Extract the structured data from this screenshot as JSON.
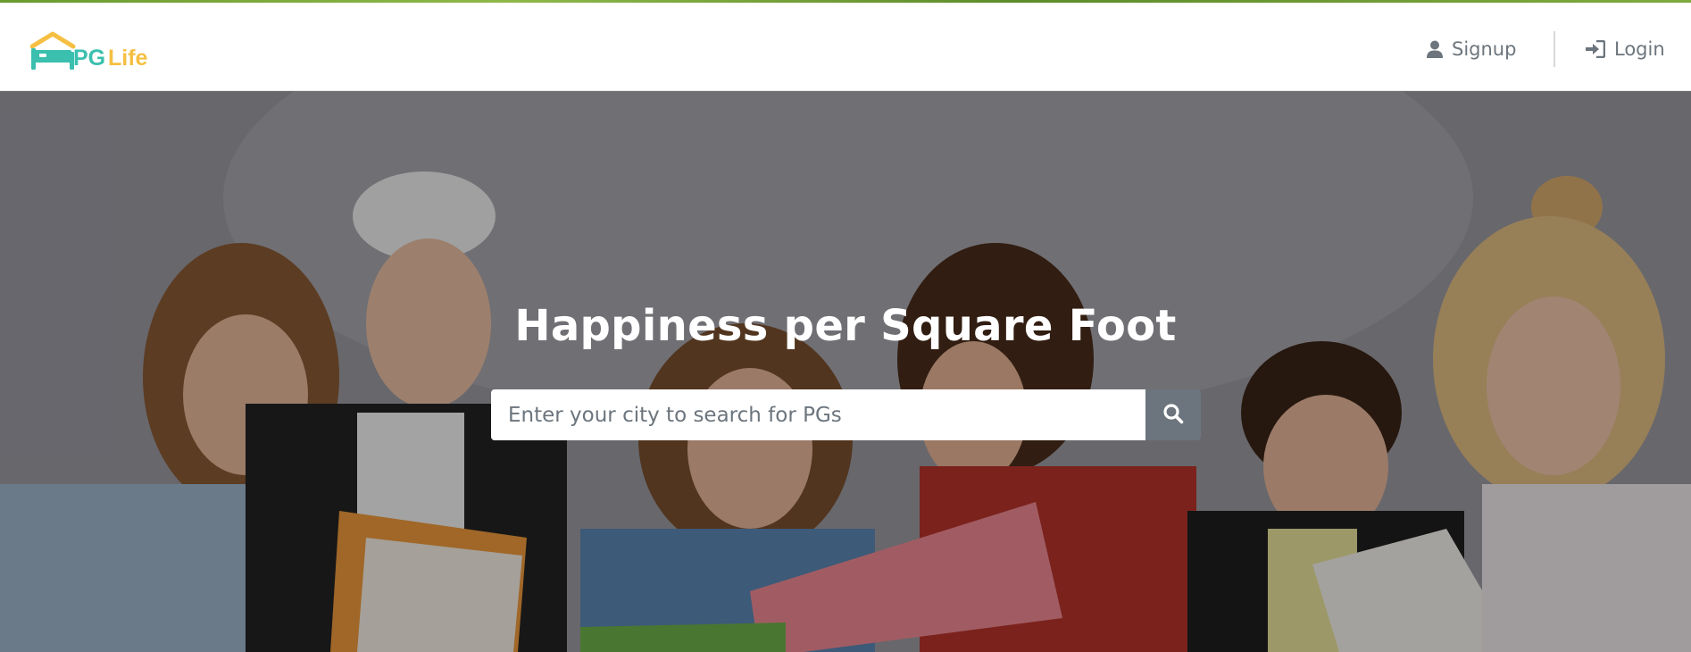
{
  "brand": {
    "name_pg": "PG",
    "name_life": "Life",
    "color_teal": "#3bbfae",
    "color_yellow": "#f5bf42"
  },
  "nav": {
    "signup_label": "Signup",
    "login_label": "Login",
    "signup_icon": "user-icon",
    "login_icon": "sign-in-icon"
  },
  "hero": {
    "title": "Happiness per Square Foot",
    "search_placeholder": "Enter your city to search for PGs",
    "search_value": "",
    "search_icon": "search-icon"
  },
  "colors": {
    "nav_text": "#6c757d",
    "search_button": "#6c757d",
    "top_strip": "#6a9a2e"
  }
}
